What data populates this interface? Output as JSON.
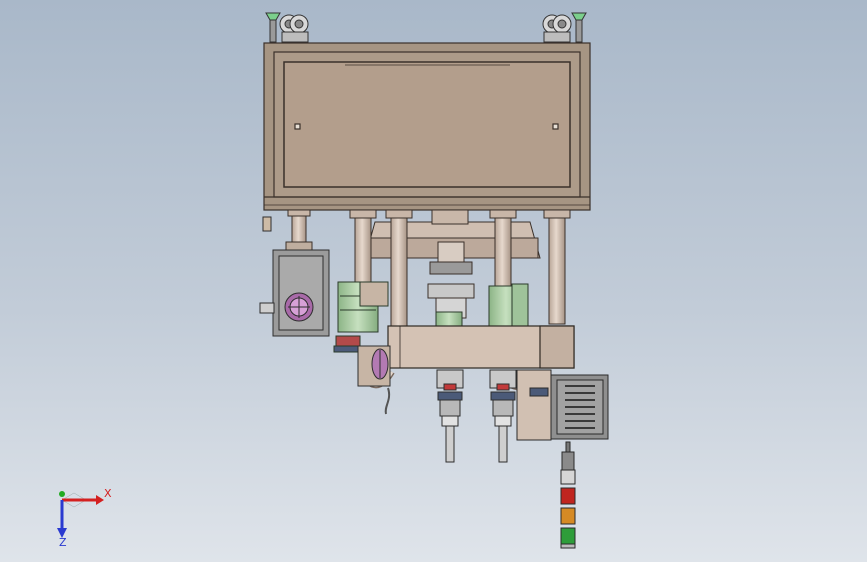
{
  "viewport": {
    "background_top": "#a9b8c9",
    "background_bottom": "#dfe4ea"
  },
  "triad": {
    "x_label": "X",
    "z_label": "Z",
    "x_color": "#d42020",
    "y_color": "#22aa22",
    "z_color": "#2a3ad0"
  },
  "model": {
    "frame_color": "#a69583",
    "panel_color": "#b39e8c",
    "column_color": "#c8b6a8",
    "green_part_color": "#a7c9a0",
    "stack_light_colors": [
      "#c0251f",
      "#d68a24",
      "#2e9d3a"
    ]
  }
}
